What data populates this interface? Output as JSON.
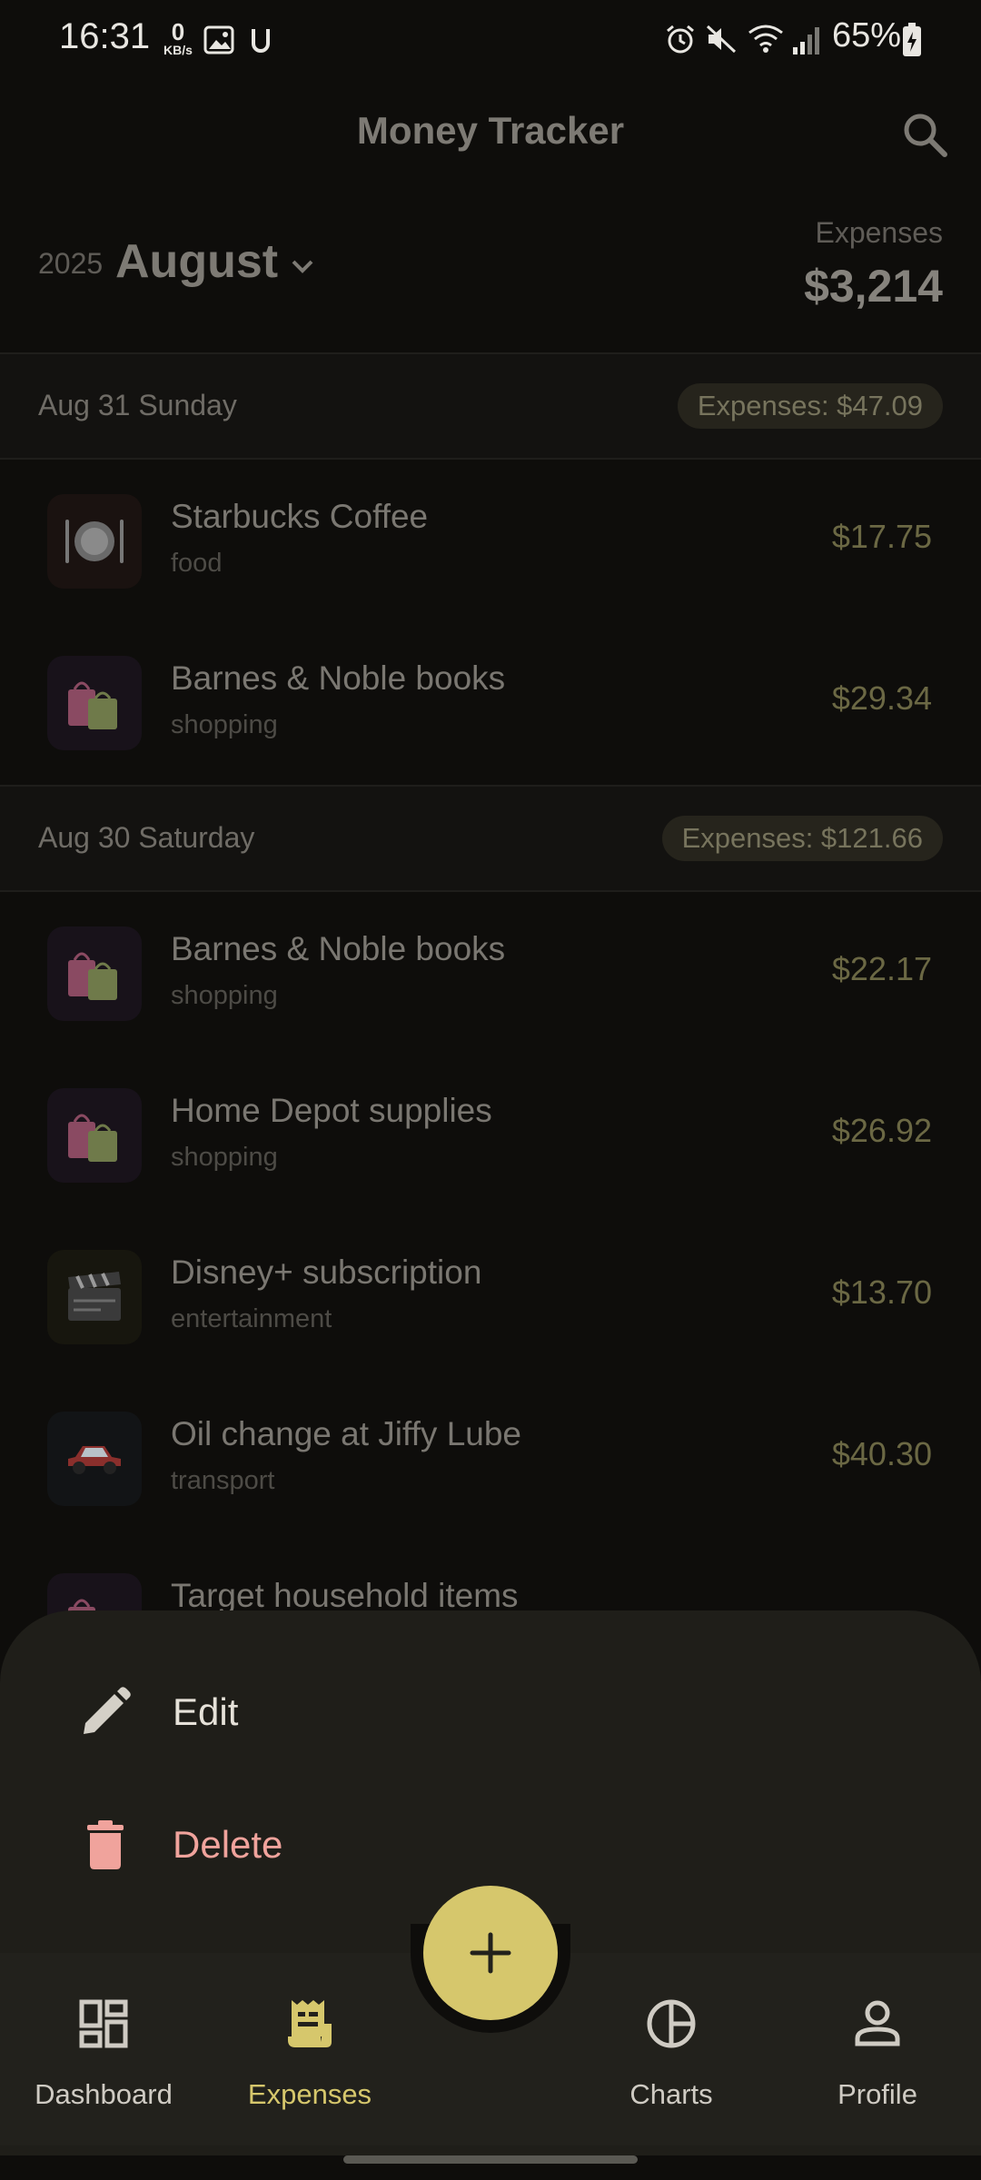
{
  "status_bar": {
    "time": "16:31",
    "net_speed_value": "0",
    "net_speed_unit": "KB/s",
    "battery": "65%"
  },
  "header": {
    "title": "Money Tracker",
    "year": "2025",
    "month": "August",
    "expenses_label": "Expenses",
    "expenses_total": "$3,214"
  },
  "days": [
    {
      "date": "Aug 31 Sunday",
      "total": "Expenses: $47.09",
      "items": [
        {
          "name": "Starbucks Coffee",
          "category": "food",
          "amount": "$17.75",
          "icon": "plate-cutlery-icon"
        },
        {
          "name": "Barnes & Noble books",
          "category": "shopping",
          "amount": "$29.34",
          "icon": "shopping-bags-icon"
        }
      ]
    },
    {
      "date": "Aug 30 Saturday",
      "total": "Expenses: $121.66",
      "items": [
        {
          "name": "Barnes & Noble books",
          "category": "shopping",
          "amount": "$22.17",
          "icon": "shopping-bags-icon"
        },
        {
          "name": "Home Depot supplies",
          "category": "shopping",
          "amount": "$26.92",
          "icon": "shopping-bags-icon"
        },
        {
          "name": "Disney+ subscription",
          "category": "entertainment",
          "amount": "$13.70",
          "icon": "clapperboard-icon"
        },
        {
          "name": "Oil change at Jiffy Lube",
          "category": "transport",
          "amount": "$40.30",
          "icon": "car-icon"
        },
        {
          "name": "Target household items",
          "category": "",
          "amount": "",
          "icon": "shopping-bags-icon"
        }
      ]
    }
  ],
  "sheet": {
    "edit_label": "Edit",
    "delete_label": "Delete"
  },
  "nav": {
    "dashboard": "Dashboard",
    "expenses": "Expenses",
    "charts": "Charts",
    "profile": "Profile"
  },
  "colors": {
    "accent": "#d6c76c",
    "delete": "#f0a39c",
    "sheet_bg": "#1f1e19"
  }
}
